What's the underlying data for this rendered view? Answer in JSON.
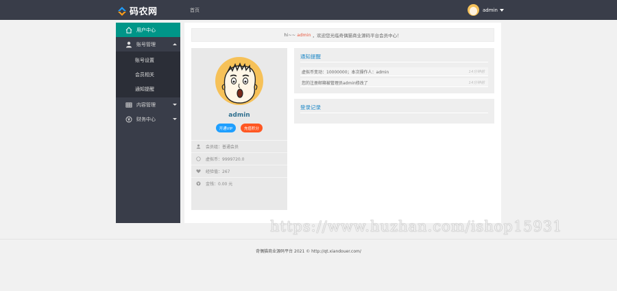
{
  "header": {
    "logo_text": "码农网",
    "nav_home": "首页",
    "user_name": "admin"
  },
  "sidebar": {
    "items": [
      {
        "label": "用户中心",
        "icon": "home-icon",
        "active": true
      },
      {
        "label": "账号管理",
        "icon": "user-icon",
        "expanded": true,
        "subitems": [
          "账号设置",
          "会员相关",
          "通知提醒"
        ]
      },
      {
        "label": "内容管理",
        "icon": "grid-icon"
      },
      {
        "label": "财务中心",
        "icon": "yen-icon"
      }
    ]
  },
  "welcome": {
    "prefix": "hi~~",
    "user": "admin",
    "message": "，欢迎您光临奇偶猫商业源码平台会员中心！"
  },
  "profile": {
    "name": "admin",
    "vip_button": "开通VIP",
    "points_button": "充值积分",
    "info": [
      {
        "icon": "user-icon",
        "text": "会员组：普通会员"
      },
      {
        "icon": "coin-icon",
        "text": "虚拟币：9999720.0"
      },
      {
        "icon": "heart-icon",
        "text": "经验值：267"
      },
      {
        "icon": "yen-icon",
        "text": "金钱：0.00 元"
      }
    ]
  },
  "notifications": {
    "title": "通知提醒",
    "items": [
      {
        "text": "虚拟币变动：10000000；本次操作人：admin",
        "time": "14分钟前"
      },
      {
        "text": "您的注册邮箱被管理员admin修改了",
        "time": "14分钟前"
      }
    ]
  },
  "login_log": {
    "title": "登录记录"
  },
  "footer": {
    "text": "奇偶猫商业源码平台 2021 © http://qt.xiandouer.com/"
  },
  "watermark": "https://www.huzhan.com/ishop15931",
  "colors": {
    "topbar": "#393d49",
    "active": "#009688",
    "vip": "#1e9fff",
    "points": "#ff5722",
    "title": "#1e88c7",
    "highlight": "#e8543a"
  }
}
